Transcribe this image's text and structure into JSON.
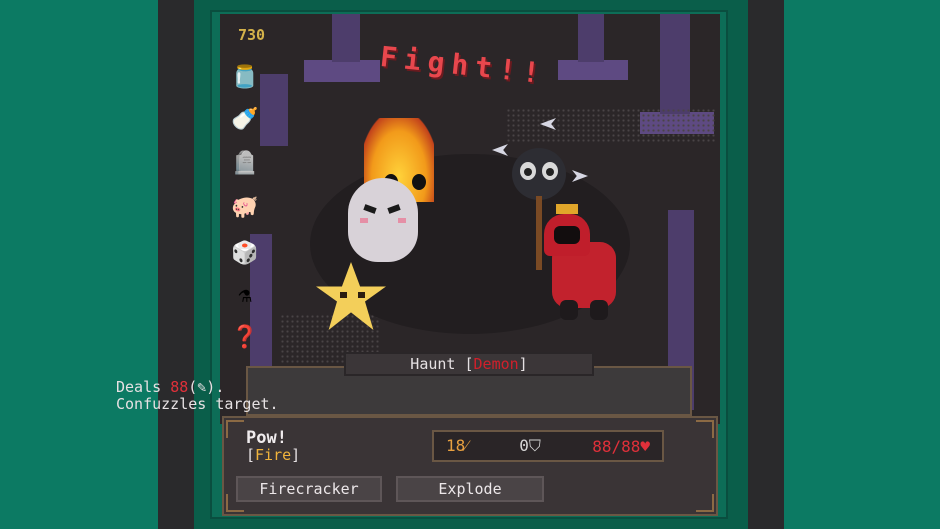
{
  "hud": {
    "gold": "730",
    "banner": "Fight!!"
  },
  "inventory": [
    {
      "icon": "cookie-jar-icon",
      "glyph": "🫙"
    },
    {
      "icon": "milk-bottle-icon",
      "glyph": "🍼"
    },
    {
      "icon": "tombstone-icon",
      "glyph": "🪦"
    },
    {
      "icon": "piggy-bank-icon",
      "glyph": "🐖"
    },
    {
      "icon": "dice-icon",
      "glyph": "🎲"
    },
    {
      "icon": "potion-icon",
      "glyph": "⚗"
    },
    {
      "icon": "mystery-box-icon",
      "glyph": "❓"
    }
  ],
  "move": {
    "name": "Haunt",
    "bracket_open": "[",
    "type": "Demon",
    "bracket_close": "]",
    "desc_prefix": "Deals ",
    "damage": "88",
    "desc_suffix": "(✎).",
    "desc_line2": "Confuzzles target."
  },
  "creature": {
    "name": "Pow!",
    "type_open": "[",
    "element": "Fire",
    "type_close": "]",
    "attack": "18",
    "defense": "0",
    "hp": "88/88",
    "atk_icon": "sword-icon",
    "def_icon": "shield-icon",
    "hp_icon": "heart-icon"
  },
  "actions": {
    "firecracker": "Firecracker",
    "explode": "Explode"
  },
  "colors": {
    "background": "#0c7a63",
    "arena": "#2b2628",
    "accent_red": "#e0303a",
    "fire_element": "#f0b33c"
  }
}
